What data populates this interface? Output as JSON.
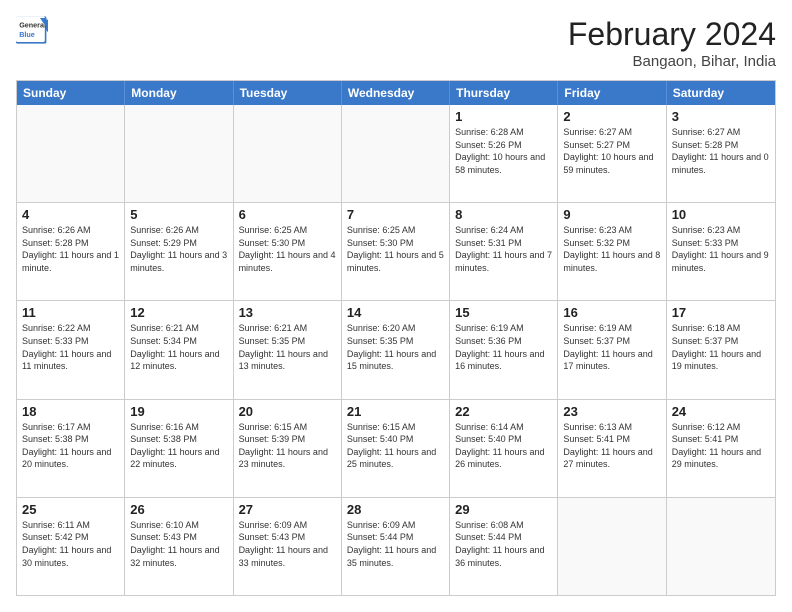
{
  "header": {
    "logo_line1": "General",
    "logo_line2": "Blue",
    "main_title": "February 2024",
    "subtitle": "Bangaon, Bihar, India"
  },
  "weekdays": [
    "Sunday",
    "Monday",
    "Tuesday",
    "Wednesday",
    "Thursday",
    "Friday",
    "Saturday"
  ],
  "rows": [
    [
      {
        "day": "",
        "info": ""
      },
      {
        "day": "",
        "info": ""
      },
      {
        "day": "",
        "info": ""
      },
      {
        "day": "",
        "info": ""
      },
      {
        "day": "1",
        "info": "Sunrise: 6:28 AM\nSunset: 5:26 PM\nDaylight: 10 hours and 58 minutes."
      },
      {
        "day": "2",
        "info": "Sunrise: 6:27 AM\nSunset: 5:27 PM\nDaylight: 10 hours and 59 minutes."
      },
      {
        "day": "3",
        "info": "Sunrise: 6:27 AM\nSunset: 5:28 PM\nDaylight: 11 hours and 0 minutes."
      }
    ],
    [
      {
        "day": "4",
        "info": "Sunrise: 6:26 AM\nSunset: 5:28 PM\nDaylight: 11 hours and 1 minute."
      },
      {
        "day": "5",
        "info": "Sunrise: 6:26 AM\nSunset: 5:29 PM\nDaylight: 11 hours and 3 minutes."
      },
      {
        "day": "6",
        "info": "Sunrise: 6:25 AM\nSunset: 5:30 PM\nDaylight: 11 hours and 4 minutes."
      },
      {
        "day": "7",
        "info": "Sunrise: 6:25 AM\nSunset: 5:30 PM\nDaylight: 11 hours and 5 minutes."
      },
      {
        "day": "8",
        "info": "Sunrise: 6:24 AM\nSunset: 5:31 PM\nDaylight: 11 hours and 7 minutes."
      },
      {
        "day": "9",
        "info": "Sunrise: 6:23 AM\nSunset: 5:32 PM\nDaylight: 11 hours and 8 minutes."
      },
      {
        "day": "10",
        "info": "Sunrise: 6:23 AM\nSunset: 5:33 PM\nDaylight: 11 hours and 9 minutes."
      }
    ],
    [
      {
        "day": "11",
        "info": "Sunrise: 6:22 AM\nSunset: 5:33 PM\nDaylight: 11 hours and 11 minutes."
      },
      {
        "day": "12",
        "info": "Sunrise: 6:21 AM\nSunset: 5:34 PM\nDaylight: 11 hours and 12 minutes."
      },
      {
        "day": "13",
        "info": "Sunrise: 6:21 AM\nSunset: 5:35 PM\nDaylight: 11 hours and 13 minutes."
      },
      {
        "day": "14",
        "info": "Sunrise: 6:20 AM\nSunset: 5:35 PM\nDaylight: 11 hours and 15 minutes."
      },
      {
        "day": "15",
        "info": "Sunrise: 6:19 AM\nSunset: 5:36 PM\nDaylight: 11 hours and 16 minutes."
      },
      {
        "day": "16",
        "info": "Sunrise: 6:19 AM\nSunset: 5:37 PM\nDaylight: 11 hours and 17 minutes."
      },
      {
        "day": "17",
        "info": "Sunrise: 6:18 AM\nSunset: 5:37 PM\nDaylight: 11 hours and 19 minutes."
      }
    ],
    [
      {
        "day": "18",
        "info": "Sunrise: 6:17 AM\nSunset: 5:38 PM\nDaylight: 11 hours and 20 minutes."
      },
      {
        "day": "19",
        "info": "Sunrise: 6:16 AM\nSunset: 5:38 PM\nDaylight: 11 hours and 22 minutes."
      },
      {
        "day": "20",
        "info": "Sunrise: 6:15 AM\nSunset: 5:39 PM\nDaylight: 11 hours and 23 minutes."
      },
      {
        "day": "21",
        "info": "Sunrise: 6:15 AM\nSunset: 5:40 PM\nDaylight: 11 hours and 25 minutes."
      },
      {
        "day": "22",
        "info": "Sunrise: 6:14 AM\nSunset: 5:40 PM\nDaylight: 11 hours and 26 minutes."
      },
      {
        "day": "23",
        "info": "Sunrise: 6:13 AM\nSunset: 5:41 PM\nDaylight: 11 hours and 27 minutes."
      },
      {
        "day": "24",
        "info": "Sunrise: 6:12 AM\nSunset: 5:41 PM\nDaylight: 11 hours and 29 minutes."
      }
    ],
    [
      {
        "day": "25",
        "info": "Sunrise: 6:11 AM\nSunset: 5:42 PM\nDaylight: 11 hours and 30 minutes."
      },
      {
        "day": "26",
        "info": "Sunrise: 6:10 AM\nSunset: 5:43 PM\nDaylight: 11 hours and 32 minutes."
      },
      {
        "day": "27",
        "info": "Sunrise: 6:09 AM\nSunset: 5:43 PM\nDaylight: 11 hours and 33 minutes."
      },
      {
        "day": "28",
        "info": "Sunrise: 6:09 AM\nSunset: 5:44 PM\nDaylight: 11 hours and 35 minutes."
      },
      {
        "day": "29",
        "info": "Sunrise: 6:08 AM\nSunset: 5:44 PM\nDaylight: 11 hours and 36 minutes."
      },
      {
        "day": "",
        "info": ""
      },
      {
        "day": "",
        "info": ""
      }
    ]
  ]
}
